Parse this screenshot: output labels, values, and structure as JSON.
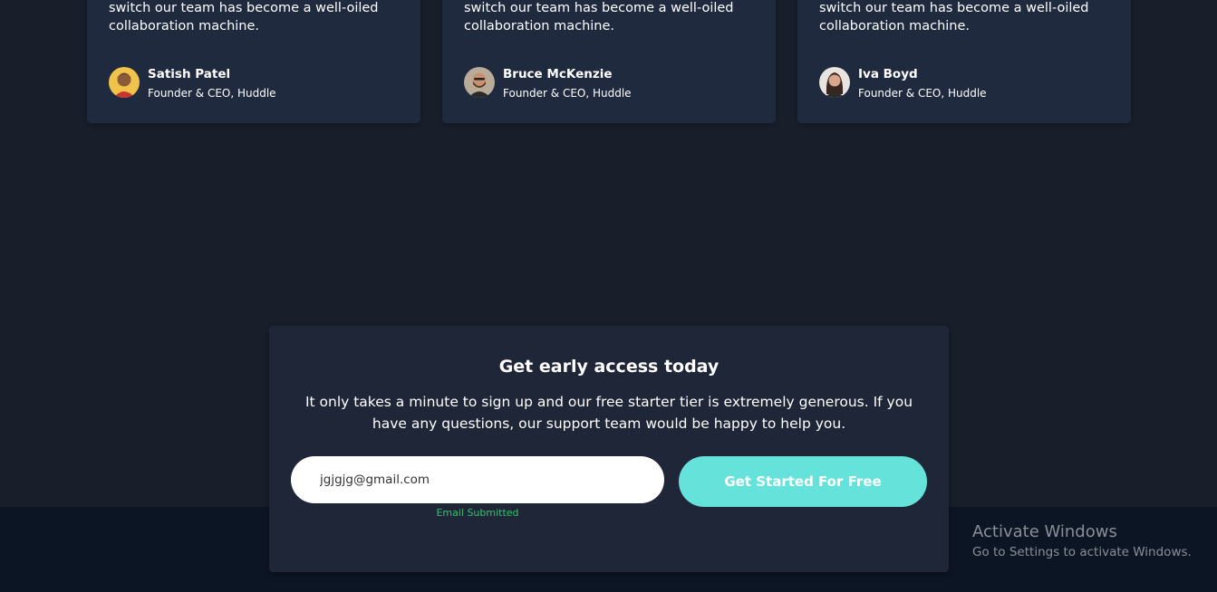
{
  "testimonials": [
    {
      "quote": "order of magnitude. Since making the switch our team has become a well-oiled collaboration machine.",
      "name": "Satish Patel",
      "role": "Founder & CEO, Huddle"
    },
    {
      "quote": "order of magnitude. Since making the switch our team has become a well-oiled collaboration machine.",
      "name": "Bruce McKenzie",
      "role": "Founder & CEO, Huddle"
    },
    {
      "quote": "order of magnitude. Since making the switch our team has become a well-oiled collaboration machine.",
      "name": "Iva Boyd",
      "role": "Founder & CEO, Huddle"
    }
  ],
  "cta": {
    "title": "Get early access today",
    "text": "It only takes a minute to sign up and our free starter tier is extremely generous. If you have any questions, our support team would be happy to help you.",
    "email_value": "jgjgjg@gmail.com",
    "status": "Email Submitted",
    "button_label": "Get Started For Free"
  },
  "watermark": {
    "title": "Activate Windows",
    "subtitle": "Go to Settings to activate Windows."
  },
  "colors": {
    "page_bg": "#181f2a",
    "card_bg": "#1f2a3f",
    "footer_bg": "#0c1524",
    "accent": "#65e2d9",
    "success": "#2fc46a"
  }
}
